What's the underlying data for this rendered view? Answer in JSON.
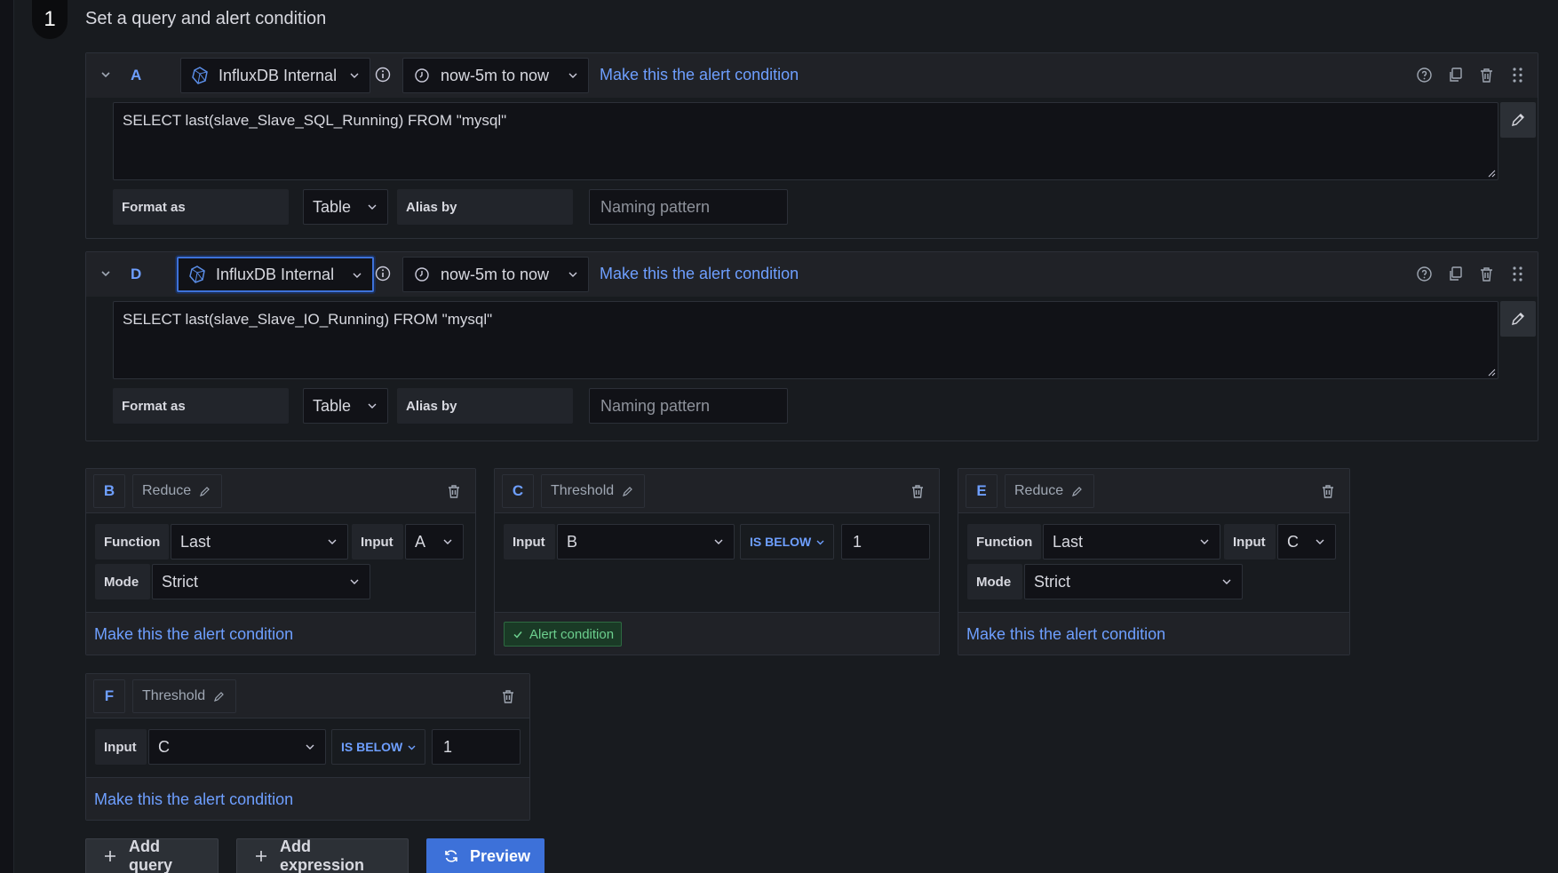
{
  "step": {
    "number": "1",
    "title": "Set a query and alert condition"
  },
  "queries": [
    {
      "ref_id": "A",
      "datasource": "InfluxDB Internal",
      "time_range": "now-5m to now",
      "make_alert_label": "Make this the alert condition",
      "query_text": "SELECT last(slave_Slave_SQL_Running) FROM \"mysql\"",
      "format_label": "Format as",
      "format_value": "Table",
      "alias_label": "Alias by",
      "alias_placeholder": "Naming pattern"
    },
    {
      "ref_id": "D",
      "datasource": "InfluxDB Internal",
      "time_range": "now-5m to now",
      "make_alert_label": "Make this the alert condition",
      "query_text": "SELECT last(slave_Slave_IO_Running) FROM \"mysql\"",
      "format_label": "Format as",
      "format_value": "Table",
      "alias_label": "Alias by",
      "alias_placeholder": "Naming pattern"
    }
  ],
  "expressions": {
    "B": {
      "ref_id": "B",
      "type": "Reduce",
      "function_label": "Function",
      "function_value": "Last",
      "input_label": "Input",
      "input_value": "A",
      "mode_label": "Mode",
      "mode_value": "Strict",
      "make_alert_label": "Make this the alert condition"
    },
    "C": {
      "ref_id": "C",
      "type": "Threshold",
      "input_label": "Input",
      "input_value": "B",
      "operator": "IS BELOW",
      "threshold": "1",
      "alert_condition_label": "Alert condition"
    },
    "E": {
      "ref_id": "E",
      "type": "Reduce",
      "function_label": "Function",
      "function_value": "Last",
      "input_label": "Input",
      "input_value": "C",
      "mode_label": "Mode",
      "mode_value": "Strict",
      "make_alert_label": "Make this the alert condition"
    },
    "F": {
      "ref_id": "F",
      "type": "Threshold",
      "input_label": "Input",
      "input_value": "C",
      "operator": "IS BELOW",
      "threshold": "1",
      "make_alert_label": "Make this the alert condition"
    }
  },
  "buttons": {
    "add_query": "Add query",
    "add_expression": "Add expression",
    "preview": "Preview"
  },
  "colors": {
    "background": "#181b1f",
    "panel_header": "#202227",
    "link": "#6e9fff",
    "primary": "#3d71d9",
    "success": "#6ccf8e"
  },
  "icons": {
    "datasource": "influxdb-icon",
    "info": "info-icon",
    "clock": "clock-icon",
    "help": "question-circle-icon",
    "duplicate": "copy-icon",
    "delete": "trash-icon",
    "drag": "drag-handle-icon",
    "edit": "pencil-icon",
    "collapse": "chevron-down-icon",
    "check": "check-icon",
    "plus": "plus-icon",
    "refresh": "sync-icon"
  }
}
